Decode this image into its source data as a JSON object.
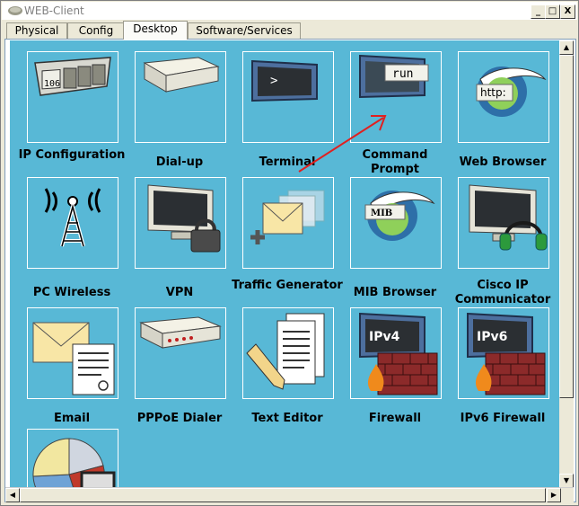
{
  "window": {
    "title": "WEB-Client",
    "minimize_label": "_",
    "maximize_label": "□",
    "close_label": "X"
  },
  "tabs": [
    {
      "label": "Physical"
    },
    {
      "label": "Config"
    },
    {
      "label": "Desktop"
    },
    {
      "label": "Software/Services"
    }
  ],
  "apps": [
    {
      "label": "IP Configuration",
      "icon": "ip-config-icon",
      "screen_text": "106"
    },
    {
      "label": "Dial-up",
      "icon": "modem-icon"
    },
    {
      "label": "Terminal",
      "icon": "terminal-icon",
      "screen_text": ">"
    },
    {
      "label": "Command Prompt",
      "icon": "command-prompt-icon",
      "screen_text": "run"
    },
    {
      "label": "Web Browser",
      "icon": "web-browser-icon",
      "screen_text": "http:"
    },
    {
      "label": "PC Wireless",
      "icon": "wireless-antenna-icon"
    },
    {
      "label": "VPN",
      "icon": "vpn-lock-icon"
    },
    {
      "label": "Traffic Generator",
      "icon": "traffic-generator-icon"
    },
    {
      "label": "MIB Browser",
      "icon": "mib-browser-icon",
      "screen_text": "MIB"
    },
    {
      "label": "Cisco IP Communicator",
      "icon": "ip-communicator-icon"
    },
    {
      "label": "Email",
      "icon": "email-icon"
    },
    {
      "label": "PPPoE Dialer",
      "icon": "pppoe-dialer-icon"
    },
    {
      "label": "Text Editor",
      "icon": "text-editor-icon"
    },
    {
      "label": "Firewall",
      "icon": "firewall-icon",
      "screen_text": "IPv4"
    },
    {
      "label": "IPv6 Firewall",
      "icon": "ipv6-firewall-icon",
      "screen_text": "IPv6"
    },
    {
      "label": "",
      "icon": "pie-chart-app-icon"
    }
  ],
  "colors": {
    "desktop_bg": "#58b8d6",
    "annotation_arrow": "#e02020"
  }
}
